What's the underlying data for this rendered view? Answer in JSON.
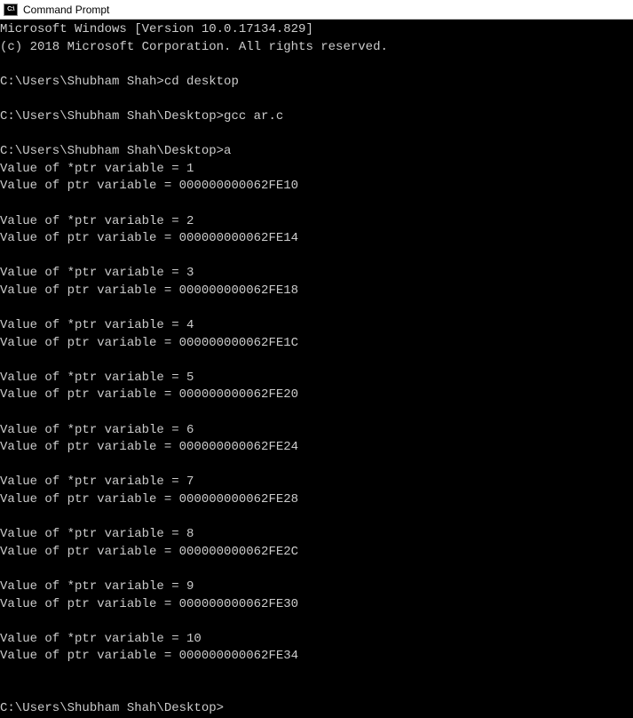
{
  "window": {
    "title": "Command Prompt",
    "icon_label": "C:\\"
  },
  "terminal": {
    "header_line1": "Microsoft Windows [Version 10.0.17134.829]",
    "header_line2": "(c) 2018 Microsoft Corporation. All rights reserved.",
    "prompt1": "C:\\Users\\Shubham Shah>",
    "cmd1": "cd desktop",
    "prompt2": "C:\\Users\\Shubham Shah\\Desktop>",
    "cmd2": "gcc ar.c",
    "prompt3": "C:\\Users\\Shubham Shah\\Desktop>",
    "cmd3": "a",
    "outputs": [
      {
        "val_line": "Value of *ptr variable = 1",
        "addr_line": "Value of ptr variable = 000000000062FE10"
      },
      {
        "val_line": "Value of *ptr variable = 2",
        "addr_line": "Value of ptr variable = 000000000062FE14"
      },
      {
        "val_line": "Value of *ptr variable = 3",
        "addr_line": "Value of ptr variable = 000000000062FE18"
      },
      {
        "val_line": "Value of *ptr variable = 4",
        "addr_line": "Value of ptr variable = 000000000062FE1C"
      },
      {
        "val_line": "Value of *ptr variable = 5",
        "addr_line": "Value of ptr variable = 000000000062FE20"
      },
      {
        "val_line": "Value of *ptr variable = 6",
        "addr_line": "Value of ptr variable = 000000000062FE24"
      },
      {
        "val_line": "Value of *ptr variable = 7",
        "addr_line": "Value of ptr variable = 000000000062FE28"
      },
      {
        "val_line": "Value of *ptr variable = 8",
        "addr_line": "Value of ptr variable = 000000000062FE2C"
      },
      {
        "val_line": "Value of *ptr variable = 9",
        "addr_line": "Value of ptr variable = 000000000062FE30"
      },
      {
        "val_line": "Value of *ptr variable = 10",
        "addr_line": "Value of ptr variable = 000000000062FE34"
      }
    ],
    "final_prompt": "C:\\Users\\Shubham Shah\\Desktop>"
  }
}
